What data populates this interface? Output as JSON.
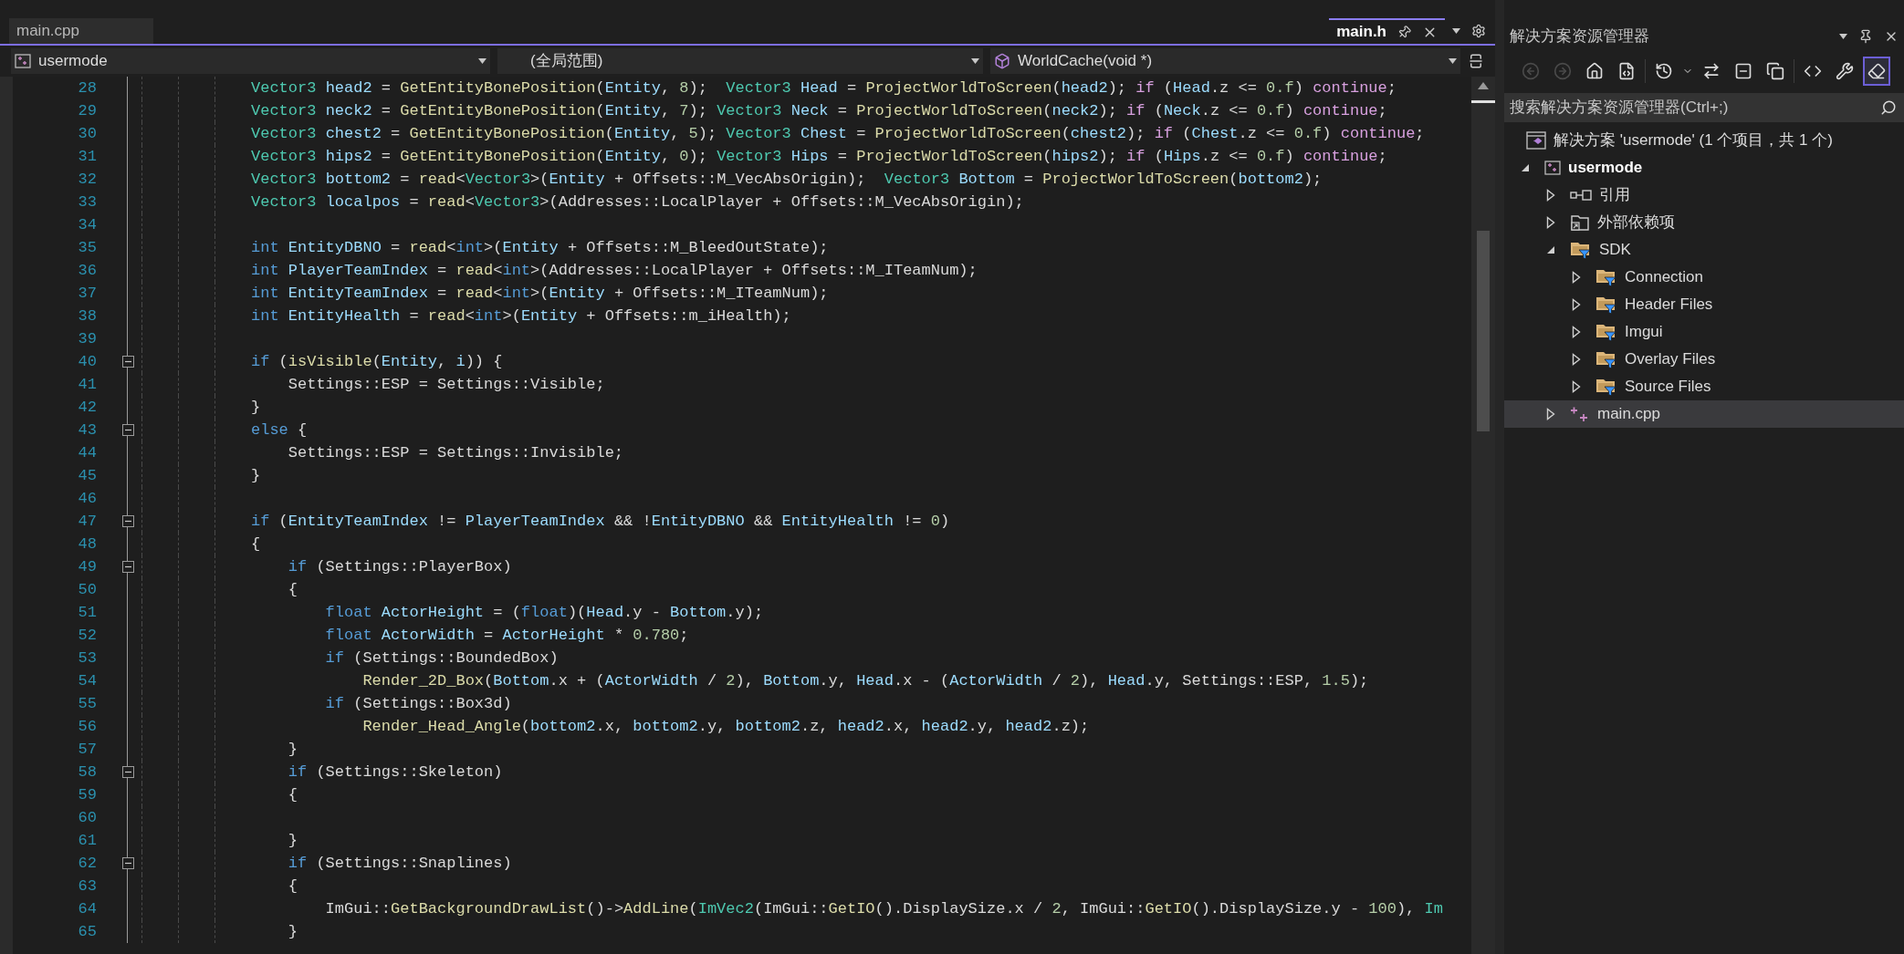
{
  "editor_tabs": [
    {
      "label": "main.cpp",
      "selected": false
    },
    {
      "label": "main.h",
      "selected": true
    }
  ],
  "nav_bar": {
    "project": "usermode",
    "scope": "(全局范围)",
    "member": "WorldCache(void *)"
  },
  "code": {
    "lines": [
      {
        "number": "28",
        "foldable": false,
        "tokens": [
          {
            "kind": "type",
            "text": "Vector3 "
          },
          {
            "kind": "var",
            "text": "head2"
          },
          {
            "kind": "p",
            "text": " = "
          },
          {
            "kind": "fn",
            "text": "GetEntityBonePosition"
          },
          {
            "kind": "p",
            "text": "("
          },
          {
            "kind": "var",
            "text": "Entity"
          },
          {
            "kind": "p",
            "text": ", "
          },
          {
            "kind": "num",
            "text": "8"
          },
          {
            "kind": "p",
            "text": ");  "
          },
          {
            "kind": "type",
            "text": "Vector3 "
          },
          {
            "kind": "var",
            "text": "Head"
          },
          {
            "kind": "p",
            "text": " = "
          },
          {
            "kind": "fn",
            "text": "ProjectWorldToScreen"
          },
          {
            "kind": "p",
            "text": "("
          },
          {
            "kind": "var",
            "text": "head2"
          },
          {
            "kind": "p",
            "text": "); "
          },
          {
            "kind": "ctl",
            "text": "if"
          },
          {
            "kind": "p",
            "text": " ("
          },
          {
            "kind": "var",
            "text": "Head"
          },
          {
            "kind": "p",
            "text": ".z <= "
          },
          {
            "kind": "num",
            "text": "0.f"
          },
          {
            "kind": "p",
            "text": ") "
          },
          {
            "kind": "ctl",
            "text": "continue"
          },
          {
            "kind": "p",
            "text": ";"
          }
        ]
      },
      {
        "number": "29",
        "foldable": false,
        "tokens": [
          {
            "kind": "type",
            "text": "Vector3 "
          },
          {
            "kind": "var",
            "text": "neck2"
          },
          {
            "kind": "p",
            "text": " = "
          },
          {
            "kind": "fn",
            "text": "GetEntityBonePosition"
          },
          {
            "kind": "p",
            "text": "("
          },
          {
            "kind": "var",
            "text": "Entity"
          },
          {
            "kind": "p",
            "text": ", "
          },
          {
            "kind": "num",
            "text": "7"
          },
          {
            "kind": "p",
            "text": "); "
          },
          {
            "kind": "type",
            "text": "Vector3 "
          },
          {
            "kind": "var",
            "text": "Neck"
          },
          {
            "kind": "p",
            "text": " = "
          },
          {
            "kind": "fn",
            "text": "ProjectWorldToScreen"
          },
          {
            "kind": "p",
            "text": "("
          },
          {
            "kind": "var",
            "text": "neck2"
          },
          {
            "kind": "p",
            "text": "); "
          },
          {
            "kind": "ctl",
            "text": "if"
          },
          {
            "kind": "p",
            "text": " ("
          },
          {
            "kind": "var",
            "text": "Neck"
          },
          {
            "kind": "p",
            "text": ".z <= "
          },
          {
            "kind": "num",
            "text": "0.f"
          },
          {
            "kind": "p",
            "text": ") "
          },
          {
            "kind": "ctl",
            "text": "continue"
          },
          {
            "kind": "p",
            "text": ";"
          }
        ]
      },
      {
        "number": "30",
        "foldable": false,
        "tokens": [
          {
            "kind": "type",
            "text": "Vector3 "
          },
          {
            "kind": "var",
            "text": "chest2"
          },
          {
            "kind": "p",
            "text": " = "
          },
          {
            "kind": "fn",
            "text": "GetEntityBonePosition"
          },
          {
            "kind": "p",
            "text": "("
          },
          {
            "kind": "var",
            "text": "Entity"
          },
          {
            "kind": "p",
            "text": ", "
          },
          {
            "kind": "num",
            "text": "5"
          },
          {
            "kind": "p",
            "text": "); "
          },
          {
            "kind": "type",
            "text": "Vector3 "
          },
          {
            "kind": "var",
            "text": "Chest"
          },
          {
            "kind": "p",
            "text": " = "
          },
          {
            "kind": "fn",
            "text": "ProjectWorldToScreen"
          },
          {
            "kind": "p",
            "text": "("
          },
          {
            "kind": "var",
            "text": "chest2"
          },
          {
            "kind": "p",
            "text": "); "
          },
          {
            "kind": "ctl",
            "text": "if"
          },
          {
            "kind": "p",
            "text": " ("
          },
          {
            "kind": "var",
            "text": "Chest"
          },
          {
            "kind": "p",
            "text": ".z <= "
          },
          {
            "kind": "num",
            "text": "0.f"
          },
          {
            "kind": "p",
            "text": ") "
          },
          {
            "kind": "ctl",
            "text": "continue"
          },
          {
            "kind": "p",
            "text": ";"
          }
        ]
      },
      {
        "number": "31",
        "foldable": false,
        "tokens": [
          {
            "kind": "type",
            "text": "Vector3 "
          },
          {
            "kind": "var",
            "text": "hips2"
          },
          {
            "kind": "p",
            "text": " = "
          },
          {
            "kind": "fn",
            "text": "GetEntityBonePosition"
          },
          {
            "kind": "p",
            "text": "("
          },
          {
            "kind": "var",
            "text": "Entity"
          },
          {
            "kind": "p",
            "text": ", "
          },
          {
            "kind": "num",
            "text": "0"
          },
          {
            "kind": "p",
            "text": "); "
          },
          {
            "kind": "type",
            "text": "Vector3 "
          },
          {
            "kind": "var",
            "text": "Hips"
          },
          {
            "kind": "p",
            "text": " = "
          },
          {
            "kind": "fn",
            "text": "ProjectWorldToScreen"
          },
          {
            "kind": "p",
            "text": "("
          },
          {
            "kind": "var",
            "text": "hips2"
          },
          {
            "kind": "p",
            "text": "); "
          },
          {
            "kind": "ctl",
            "text": "if"
          },
          {
            "kind": "p",
            "text": " ("
          },
          {
            "kind": "var",
            "text": "Hips"
          },
          {
            "kind": "p",
            "text": ".z <= "
          },
          {
            "kind": "num",
            "text": "0.f"
          },
          {
            "kind": "p",
            "text": ") "
          },
          {
            "kind": "ctl",
            "text": "continue"
          },
          {
            "kind": "p",
            "text": ";"
          }
        ]
      },
      {
        "number": "32",
        "foldable": false,
        "tokens": [
          {
            "kind": "type",
            "text": "Vector3 "
          },
          {
            "kind": "var",
            "text": "bottom2"
          },
          {
            "kind": "p",
            "text": " = "
          },
          {
            "kind": "fn",
            "text": "read"
          },
          {
            "kind": "p",
            "text": "<"
          },
          {
            "kind": "type",
            "text": "Vector3"
          },
          {
            "kind": "p",
            "text": ">("
          },
          {
            "kind": "var",
            "text": "Entity"
          },
          {
            "kind": "p",
            "text": " + Offsets::M_VecAbsOrigin);  "
          },
          {
            "kind": "type",
            "text": "Vector3 "
          },
          {
            "kind": "var",
            "text": "Bottom"
          },
          {
            "kind": "p",
            "text": " = "
          },
          {
            "kind": "fn",
            "text": "ProjectWorldToScreen"
          },
          {
            "kind": "p",
            "text": "("
          },
          {
            "kind": "var",
            "text": "bottom2"
          },
          {
            "kind": "p",
            "text": ");"
          }
        ]
      },
      {
        "number": "33",
        "foldable": false,
        "tokens": [
          {
            "kind": "type",
            "text": "Vector3 "
          },
          {
            "kind": "var",
            "text": "localpos"
          },
          {
            "kind": "p",
            "text": " = "
          },
          {
            "kind": "fn",
            "text": "read"
          },
          {
            "kind": "p",
            "text": "<"
          },
          {
            "kind": "type",
            "text": "Vector3"
          },
          {
            "kind": "p",
            "text": ">(Addresses::LocalPlayer + Offsets::M_VecAbsOrigin);"
          }
        ]
      },
      {
        "number": "34",
        "foldable": false
      },
      {
        "number": "35",
        "foldable": false,
        "tokens": [
          {
            "kind": "kw",
            "text": "int "
          },
          {
            "kind": "var",
            "text": "EntityDBNO"
          },
          {
            "kind": "p",
            "text": " = "
          },
          {
            "kind": "fn",
            "text": "read"
          },
          {
            "kind": "p",
            "text": "<"
          },
          {
            "kind": "kw",
            "text": "int"
          },
          {
            "kind": "p",
            "text": ">("
          },
          {
            "kind": "var",
            "text": "Entity"
          },
          {
            "kind": "p",
            "text": " + Offsets::M_BleedOutState);"
          }
        ]
      },
      {
        "number": "36",
        "foldable": false,
        "tokens": [
          {
            "kind": "kw",
            "text": "int "
          },
          {
            "kind": "var",
            "text": "PlayerTeamIndex"
          },
          {
            "kind": "p",
            "text": " = "
          },
          {
            "kind": "fn",
            "text": "read"
          },
          {
            "kind": "p",
            "text": "<"
          },
          {
            "kind": "kw",
            "text": "int"
          },
          {
            "kind": "p",
            "text": ">(Addresses::LocalPlayer + Offsets::M_ITeamNum);"
          }
        ]
      },
      {
        "number": "37",
        "foldable": false,
        "tokens": [
          {
            "kind": "kw",
            "text": "int "
          },
          {
            "kind": "var",
            "text": "EntityTeamIndex"
          },
          {
            "kind": "p",
            "text": " = "
          },
          {
            "kind": "fn",
            "text": "read"
          },
          {
            "kind": "p",
            "text": "<"
          },
          {
            "kind": "kw",
            "text": "int"
          },
          {
            "kind": "p",
            "text": ">("
          },
          {
            "kind": "var",
            "text": "Entity"
          },
          {
            "kind": "p",
            "text": " + Offsets::M_ITeamNum);"
          }
        ]
      },
      {
        "number": "38",
        "foldable": false,
        "tokens": [
          {
            "kind": "kw",
            "text": "int "
          },
          {
            "kind": "var",
            "text": "EntityHealth"
          },
          {
            "kind": "p",
            "text": " = "
          },
          {
            "kind": "fn",
            "text": "read"
          },
          {
            "kind": "p",
            "text": "<"
          },
          {
            "kind": "kw",
            "text": "int"
          },
          {
            "kind": "p",
            "text": ">("
          },
          {
            "kind": "var",
            "text": "Entity"
          },
          {
            "kind": "p",
            "text": " + Offsets::m_iHealth);"
          }
        ]
      },
      {
        "number": "39",
        "foldable": false
      },
      {
        "number": "40",
        "foldable": true,
        "tokens": [
          {
            "kind": "kw",
            "text": "if"
          },
          {
            "kind": "p",
            "text": " ("
          },
          {
            "kind": "fn",
            "text": "isVisible"
          },
          {
            "kind": "p",
            "text": "("
          },
          {
            "kind": "var",
            "text": "Entity"
          },
          {
            "kind": "p",
            "text": ", "
          },
          {
            "kind": "var",
            "text": "i"
          },
          {
            "kind": "p",
            "text": ")) {"
          }
        ]
      },
      {
        "number": "41",
        "foldable": false,
        "tokens": [
          {
            "kind": "p",
            "text": "    Settings::ESP = Settings::Visible;"
          }
        ]
      },
      {
        "number": "42",
        "foldable": false,
        "tokens": [
          {
            "kind": "p",
            "text": "}"
          }
        ]
      },
      {
        "number": "43",
        "foldable": true,
        "tokens": [
          {
            "kind": "kw",
            "text": "else"
          },
          {
            "kind": "p",
            "text": " {"
          }
        ]
      },
      {
        "number": "44",
        "foldable": false,
        "tokens": [
          {
            "kind": "p",
            "text": "    Settings::ESP = Settings::Invisible;"
          }
        ]
      },
      {
        "number": "45",
        "foldable": false,
        "tokens": [
          {
            "kind": "p",
            "text": "}"
          }
        ]
      },
      {
        "number": "46",
        "foldable": false
      },
      {
        "number": "47",
        "foldable": true,
        "tokens": [
          {
            "kind": "kw",
            "text": "if"
          },
          {
            "kind": "p",
            "text": " ("
          },
          {
            "kind": "var",
            "text": "EntityTeamIndex"
          },
          {
            "kind": "p",
            "text": " != "
          },
          {
            "kind": "var",
            "text": "PlayerTeamIndex"
          },
          {
            "kind": "p",
            "text": " && !"
          },
          {
            "kind": "var",
            "text": "EntityDBNO"
          },
          {
            "kind": "p",
            "text": " && "
          },
          {
            "kind": "var",
            "text": "EntityHealth"
          },
          {
            "kind": "p",
            "text": " != "
          },
          {
            "kind": "num",
            "text": "0"
          },
          {
            "kind": "p",
            "text": ")"
          }
        ]
      },
      {
        "number": "48",
        "foldable": false,
        "tokens": [
          {
            "kind": "p",
            "text": "{"
          }
        ]
      },
      {
        "number": "49",
        "foldable": true,
        "tokens": [
          {
            "kind": "kw",
            "text": "    if"
          },
          {
            "kind": "p",
            "text": " (Settings::PlayerBox)"
          }
        ]
      },
      {
        "number": "50",
        "foldable": false,
        "tokens": [
          {
            "kind": "p",
            "text": "    {"
          }
        ]
      },
      {
        "number": "51",
        "foldable": false,
        "tokens": [
          {
            "kind": "kw",
            "text": "        float "
          },
          {
            "kind": "var",
            "text": "ActorHeight"
          },
          {
            "kind": "p",
            "text": " = ("
          },
          {
            "kind": "kw",
            "text": "float"
          },
          {
            "kind": "p",
            "text": ")("
          },
          {
            "kind": "var",
            "text": "Head"
          },
          {
            "kind": "p",
            "text": ".y - "
          },
          {
            "kind": "var",
            "text": "Bottom"
          },
          {
            "kind": "p",
            "text": ".y);"
          }
        ]
      },
      {
        "number": "52",
        "foldable": false,
        "tokens": [
          {
            "kind": "kw",
            "text": "        float "
          },
          {
            "kind": "var",
            "text": "ActorWidth"
          },
          {
            "kind": "p",
            "text": " = "
          },
          {
            "kind": "var",
            "text": "ActorHeight"
          },
          {
            "kind": "p",
            "text": " * "
          },
          {
            "kind": "num",
            "text": "0.780"
          },
          {
            "kind": "p",
            "text": ";"
          }
        ]
      },
      {
        "number": "53",
        "foldable": false,
        "tokens": [
          {
            "kind": "kw",
            "text": "        if"
          },
          {
            "kind": "p",
            "text": " (Settings::BoundedBox)"
          }
        ]
      },
      {
        "number": "54",
        "foldable": false,
        "tokens": [
          {
            "kind": "fn",
            "text": "            Render_2D_Box"
          },
          {
            "kind": "p",
            "text": "("
          },
          {
            "kind": "var",
            "text": "Bottom"
          },
          {
            "kind": "p",
            "text": ".x + ("
          },
          {
            "kind": "var",
            "text": "ActorWidth"
          },
          {
            "kind": "p",
            "text": " / "
          },
          {
            "kind": "num",
            "text": "2"
          },
          {
            "kind": "p",
            "text": "), "
          },
          {
            "kind": "var",
            "text": "Bottom"
          },
          {
            "kind": "p",
            "text": ".y, "
          },
          {
            "kind": "var",
            "text": "Head"
          },
          {
            "kind": "p",
            "text": ".x - ("
          },
          {
            "kind": "var",
            "text": "ActorWidth"
          },
          {
            "kind": "p",
            "text": " / "
          },
          {
            "kind": "num",
            "text": "2"
          },
          {
            "kind": "p",
            "text": "), "
          },
          {
            "kind": "var",
            "text": "Head"
          },
          {
            "kind": "p",
            "text": ".y, Settings::ESP, "
          },
          {
            "kind": "num",
            "text": "1.5"
          },
          {
            "kind": "p",
            "text": ");"
          }
        ]
      },
      {
        "number": "55",
        "foldable": false,
        "tokens": [
          {
            "kind": "kw",
            "text": "        if"
          },
          {
            "kind": "p",
            "text": " (Settings::Box3d)"
          }
        ]
      },
      {
        "number": "56",
        "foldable": false,
        "tokens": [
          {
            "kind": "fn",
            "text": "            Render_Head_Angle"
          },
          {
            "kind": "p",
            "text": "("
          },
          {
            "kind": "var",
            "text": "bottom2"
          },
          {
            "kind": "p",
            "text": ".x, "
          },
          {
            "kind": "var",
            "text": "bottom2"
          },
          {
            "kind": "p",
            "text": ".y, "
          },
          {
            "kind": "var",
            "text": "bottom2"
          },
          {
            "kind": "p",
            "text": ".z, "
          },
          {
            "kind": "var",
            "text": "head2"
          },
          {
            "kind": "p",
            "text": ".x, "
          },
          {
            "kind": "var",
            "text": "head2"
          },
          {
            "kind": "p",
            "text": ".y, "
          },
          {
            "kind": "var",
            "text": "head2"
          },
          {
            "kind": "p",
            "text": ".z);"
          }
        ]
      },
      {
        "number": "57",
        "foldable": false,
        "tokens": [
          {
            "kind": "p",
            "text": "    }"
          }
        ]
      },
      {
        "number": "58",
        "foldable": true,
        "tokens": [
          {
            "kind": "kw",
            "text": "    if"
          },
          {
            "kind": "p",
            "text": " (Settings::Skeleton)"
          }
        ]
      },
      {
        "number": "59",
        "foldable": false,
        "tokens": [
          {
            "kind": "p",
            "text": "    {"
          }
        ]
      },
      {
        "number": "60",
        "foldable": false
      },
      {
        "number": "61",
        "foldable": false,
        "tokens": [
          {
            "kind": "p",
            "text": "    }"
          }
        ]
      },
      {
        "number": "62",
        "foldable": true,
        "tokens": [
          {
            "kind": "kw",
            "text": "    if"
          },
          {
            "kind": "p",
            "text": " (Settings::Snaplines)"
          }
        ]
      },
      {
        "number": "63",
        "foldable": false,
        "tokens": [
          {
            "kind": "p",
            "text": "    {"
          }
        ]
      },
      {
        "number": "64",
        "foldable": false,
        "tokens": [
          {
            "kind": "p",
            "text": "        ImGui::"
          },
          {
            "kind": "fn",
            "text": "GetBackgroundDrawList"
          },
          {
            "kind": "p",
            "text": "()->"
          },
          {
            "kind": "fn",
            "text": "AddLine"
          },
          {
            "kind": "p",
            "text": "("
          },
          {
            "kind": "type",
            "text": "ImVec2"
          },
          {
            "kind": "p",
            "text": "(ImGui::"
          },
          {
            "kind": "fn",
            "text": "GetIO"
          },
          {
            "kind": "p",
            "text": "().DisplaySize.x / "
          },
          {
            "kind": "num",
            "text": "2"
          },
          {
            "kind": "p",
            "text": ", ImGui::"
          },
          {
            "kind": "fn",
            "text": "GetIO"
          },
          {
            "kind": "p",
            "text": "().DisplaySize.y - "
          },
          {
            "kind": "num",
            "text": "100"
          },
          {
            "kind": "p",
            "text": "), "
          },
          {
            "kind": "type",
            "text": "Im"
          }
        ]
      },
      {
        "number": "65",
        "foldable": false,
        "tokens": [
          {
            "kind": "p",
            "text": "    }"
          }
        ]
      }
    ]
  },
  "solution_explorer": {
    "title": "解决方案资源管理器",
    "toolbar": [
      {
        "kind": "back",
        "disabled": true,
        "selected": false
      },
      {
        "kind": "forward",
        "disabled": true,
        "selected": false
      },
      {
        "kind": "home",
        "disabled": false,
        "selected": false
      },
      {
        "kind": "switch",
        "disabled": false,
        "selected": false
      },
      {
        "kind": "history",
        "disabled": false,
        "selected": false
      },
      {
        "kind": "dropdown",
        "disabled": false,
        "selected": false
      },
      {
        "kind": "sync",
        "disabled": false,
        "selected": false
      },
      {
        "kind": "collapse",
        "disabled": false,
        "selected": false
      },
      {
        "kind": "showall",
        "disabled": false,
        "selected": false
      },
      {
        "kind": "code",
        "disabled": false,
        "selected": false
      },
      {
        "kind": "properties",
        "disabled": false,
        "selected": false
      },
      {
        "kind": "preview",
        "disabled": false,
        "selected": true
      }
    ],
    "search": {
      "placeholder": "搜索解决方案资源管理器(Ctrl+;)"
    },
    "tree": [
      {
        "label": "解决方案 'usermode' (1 个项目，共 1 个)",
        "kind": "solution",
        "selected": false,
        "children": [
          {
            "label": "usermode",
            "kind": "project",
            "expanded": true,
            "selected": false,
            "children": [
              {
                "label": "引用",
                "kind": "references",
                "expanded": false,
                "selected": false
              },
              {
                "label": "外部依赖项",
                "kind": "external",
                "expanded": false,
                "selected": false
              },
              {
                "label": "SDK",
                "kind": "filter",
                "expanded": true,
                "selected": false,
                "children": [
                  {
                    "label": "Connection",
                    "kind": "filter",
                    "expanded": false,
                    "selected": false
                  },
                  {
                    "label": "Header Files",
                    "kind": "filter",
                    "expanded": false,
                    "selected": false
                  },
                  {
                    "label": "Imgui",
                    "kind": "filter",
                    "expanded": false,
                    "selected": false
                  },
                  {
                    "label": "Overlay Files",
                    "kind": "filter",
                    "expanded": false,
                    "selected": false
                  },
                  {
                    "label": "Source Files",
                    "kind": "filter",
                    "expanded": false,
                    "selected": false
                  }
                ]
              },
              {
                "label": "main.cpp",
                "kind": "cpp",
                "expanded": false,
                "selected": true
              }
            ]
          }
        ]
      }
    ]
  }
}
